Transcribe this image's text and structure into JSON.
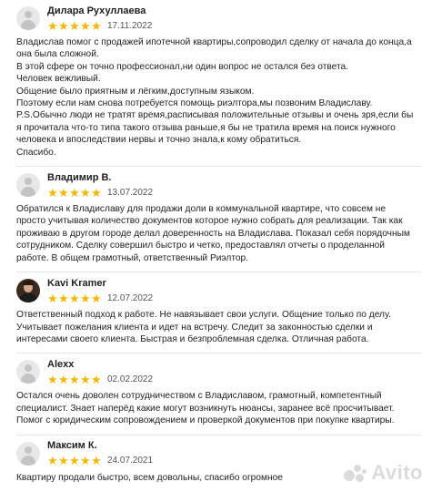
{
  "reviews": [
    {
      "name": "Дилара Рухуллаева",
      "date": "17.11.2022",
      "lines": [
        "Владислав помог с продажей ипотечной квартиры,сопроводил сделку от начала до конца,а она была сложной.",
        "В этой сфере он точно профессионал,ни один вопрос не остался без ответа.",
        "Человек вежливый.",
        "Общение было приятным и лёгким,доступным языком.",
        "Поэтому если нам снова потребуется помощь риэлтора,мы позвоним Владиславу.",
        "P.S.Обычно люди не тратят время,расписывая положительные отзывы и очень зря,если бы я прочитала что-то типа такого отзыва раньше,я бы не тратила время на поиск нужного человека и впоследствии нервы и точно знала,к кому обратиться.",
        "Спасибо."
      ]
    },
    {
      "name": "Владимир В.",
      "date": "13.07.2022",
      "lines": [
        "Обратился к Владиславу для продажи доли в коммунальной квартире, что совсем не просто учитывая количество документов которое нужно собрать для реализации. Так как проживаю в другом городе делал доверенность на Владислава. Показал себя порядочным сотрудником. Сделку совершил быстро и четко, предоставлял отчеты о проделанной работе. В общем грамотный, ответственный Риэлтор."
      ]
    },
    {
      "name": "Kavi Kramer",
      "date": "12.07.2022",
      "lines": [
        "Ответственный подход к работе. Не навязывает свои услуги. Общение только по делу. Учитывает пожелания клиента и идет на встречу. Следит за законностью сделки и интересами своего клиента. Быстрая и безпроблемная сделка. Отличная работа."
      ]
    },
    {
      "name": "Alexx",
      "date": "02.02.2022",
      "lines": [
        "Остался очень доволен сотрудничеством с Владиславом, грамотный, компетентный специалист. Знает наперёд какие могут возникнуть нюансы, заранее всё просчитывает. Помог с юридическим сопровождением и проверкой документов при покупке квартиры."
      ]
    },
    {
      "name": "Максим К.",
      "date": "24.07.2021",
      "lines": [
        "Квартиру продали быстро, всем довольны, спасибо огромное"
      ]
    }
  ],
  "stars_per_review": 5,
  "colors": {
    "star": "#f5b800",
    "divider": "#e6e6e6"
  },
  "watermark": {
    "text": "Avito"
  }
}
